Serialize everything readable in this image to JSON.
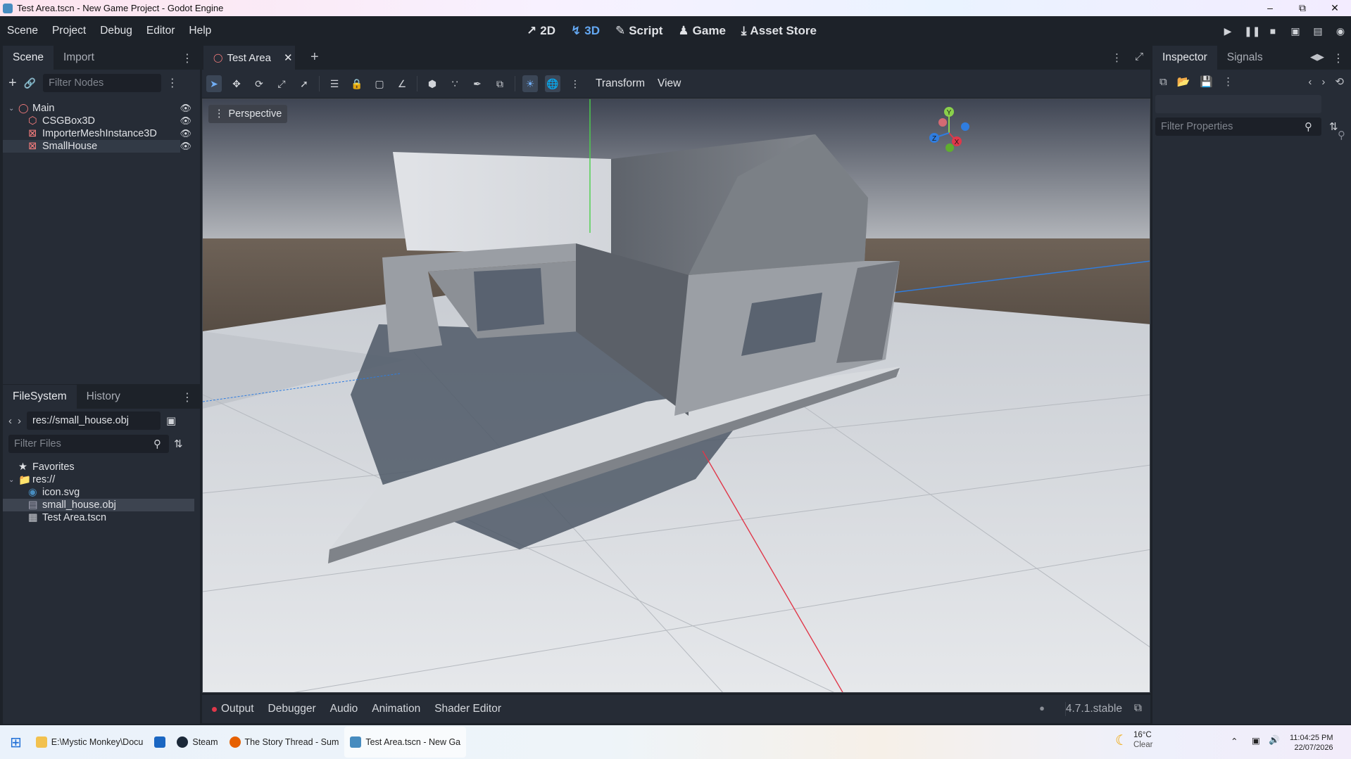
{
  "window": {
    "title": "Test Area.tscn - New Game Project - Godot Engine"
  },
  "menu": [
    "Scene",
    "Project",
    "Debug",
    "Editor",
    "Help"
  ],
  "modes": [
    {
      "label": "2D",
      "icon": "2d-icon"
    },
    {
      "label": "3D",
      "icon": "3d-icon",
      "active": true
    },
    {
      "label": "Script",
      "icon": "script-icon"
    },
    {
      "label": "Game",
      "icon": "game-icon"
    },
    {
      "label": "Asset Store",
      "icon": "asset-store-icon"
    }
  ],
  "scene_dock": {
    "tabs": [
      "Scene",
      "Import"
    ],
    "filter_placeholder": "Filter Nodes",
    "nodes": [
      {
        "label": "Main",
        "icon": "node3d-icon",
        "color": "#fc7f7f"
      },
      {
        "label": "CSGBox3D",
        "icon": "csgbox-icon",
        "color": "#fc7f7f"
      },
      {
        "label": "ImporterMeshInstance3D",
        "icon": "mesh-instance-icon",
        "color": "#fc7f7f"
      },
      {
        "label": "SmallHouse",
        "icon": "mesh-instance-icon",
        "color": "#fc7f7f"
      }
    ]
  },
  "filesystem_dock": {
    "tabs": [
      "FileSystem",
      "History"
    ],
    "path": "res://small_house.obj",
    "filter_placeholder": "Filter Files",
    "items": [
      {
        "label": "Favorites",
        "icon": "star-icon"
      },
      {
        "label": "res://",
        "icon": "folder-icon"
      },
      {
        "label": "icon.svg",
        "icon": "svg-file-icon"
      },
      {
        "label": "small_house.obj",
        "icon": "mesh-file-icon",
        "selected": true
      },
      {
        "label": "Test Area.tscn",
        "icon": "scene-file-icon"
      }
    ]
  },
  "editor_tab": {
    "label": "Test Area"
  },
  "viewport": {
    "toolbar_menus": [
      "Transform",
      "View"
    ],
    "perspective_label": "Perspective"
  },
  "gizmo": {
    "y": "Y",
    "x": "X",
    "z": "Z"
  },
  "inspector": {
    "tabs": [
      "Inspector",
      "Signals"
    ],
    "filter_placeholder": "Filter Properties"
  },
  "bottom_panel": {
    "tabs": [
      "Output",
      "Debugger",
      "Audio",
      "Animation",
      "Shader Editor"
    ],
    "version": "4.7.1.stable"
  },
  "taskbar": {
    "items": [
      {
        "label": "E:\\Mystic Monkey\\Docu",
        "icon": "file-explorer-icon"
      },
      {
        "label": "",
        "icon": "outlook-icon"
      },
      {
        "label": "Steam",
        "icon": "steam-icon"
      },
      {
        "label": "The Story Thread - Sum",
        "icon": "firefox-icon"
      },
      {
        "label": "Test Area.tscn - New Ga",
        "icon": "godot-icon"
      }
    ],
    "weather": {
      "temp": "16°C",
      "condition": "Clear"
    },
    "time": "11:04:25 PM",
    "date": "22/07/2026"
  }
}
